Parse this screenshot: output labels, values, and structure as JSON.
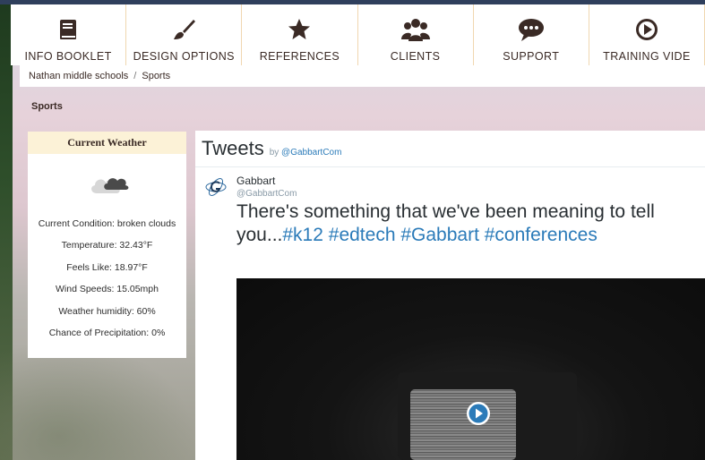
{
  "nav": {
    "items": [
      {
        "label": "INFO BOOKLET",
        "icon": "book-icon"
      },
      {
        "label": "DESIGN OPTIONS",
        "icon": "paintbrush-icon"
      },
      {
        "label": "REFERENCES",
        "icon": "star-icon"
      },
      {
        "label": "CLIENTS",
        "icon": "users-icon"
      },
      {
        "label": "SUPPORT",
        "icon": "chat-bubble-icon"
      },
      {
        "label": "TRAINING VIDE",
        "icon": "play-circle-icon"
      }
    ]
  },
  "breadcrumb": [
    "Nathan middle schools",
    "Sports"
  ],
  "breadcrumb_sep": "/",
  "section_title": "Sports",
  "weather": {
    "title": "Current Weather",
    "icon": "cloud-icon",
    "rows": [
      "Current Condition: broken clouds",
      "Temperature: 32.43°F",
      "Feels Like: 18.97°F",
      "Wind Speeds: 15.05mph",
      "Weather humidity: 60%",
      "Chance of Precipitation: 0%"
    ]
  },
  "tweets": {
    "title": "Tweets",
    "by_prefix": "by",
    "by_handle": "@GabbartCom",
    "tweet": {
      "name": "Gabbart",
      "handle": "@GabbartCom",
      "text_plain": "There's something that we've been meaning to tell you...",
      "hashtags": [
        "#k12",
        "#edtech",
        "#Gabbart",
        "#conferences"
      ],
      "media_icon": "play-button-icon"
    }
  },
  "colors": {
    "nav_text": "#3a2a25",
    "weather_header_bg": "#fcf2d7",
    "link": "#2b7bb9"
  }
}
